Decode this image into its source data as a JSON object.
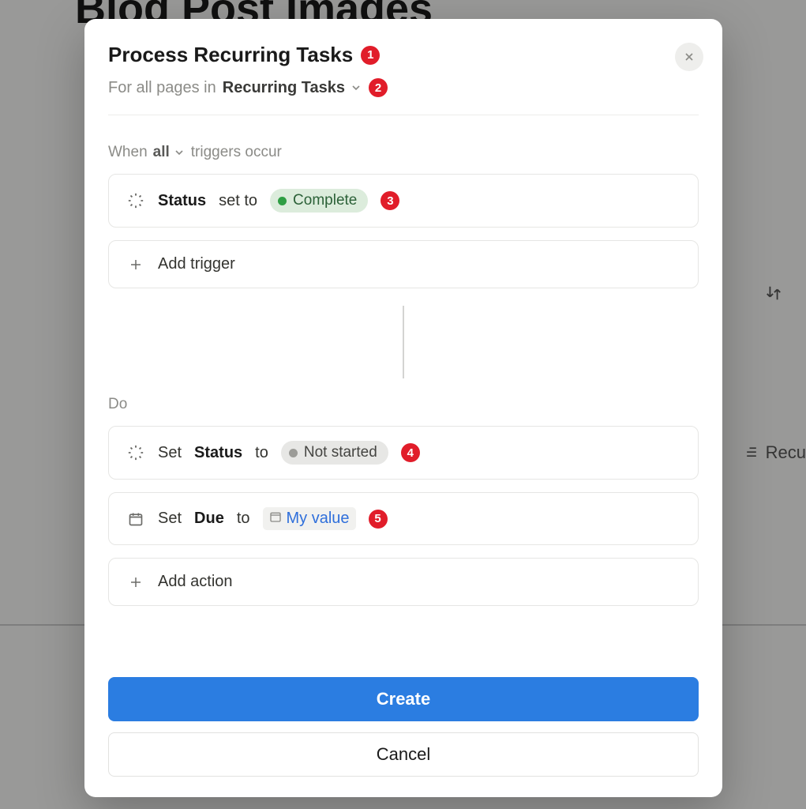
{
  "backdrop": {
    "page_title": "Blog Post Images",
    "column_label": "Recu"
  },
  "modal": {
    "title": "Process Recurring Tasks",
    "scope_prefix": "For all pages in",
    "scope_db": "Recurring Tasks",
    "when": {
      "prefix": "When",
      "mode": "all",
      "suffix": "triggers occur"
    },
    "triggers": [
      {
        "property": "Status",
        "verb": "set to",
        "value_label": "Complete",
        "value_style": "green"
      }
    ],
    "add_trigger_label": "Add trigger",
    "do_label": "Do",
    "actions": [
      {
        "kind": "status",
        "prefix": "Set",
        "property": "Status",
        "mid": "to",
        "value_label": "Not started",
        "value_style": "gray"
      },
      {
        "kind": "date",
        "prefix": "Set",
        "property": "Due",
        "mid": "to",
        "formula_label": "My value"
      }
    ],
    "add_action_label": "Add action",
    "create_label": "Create",
    "cancel_label": "Cancel"
  },
  "annotations": {
    "b1": "1",
    "b2": "2",
    "b3": "3",
    "b4": "4",
    "b5": "5"
  }
}
